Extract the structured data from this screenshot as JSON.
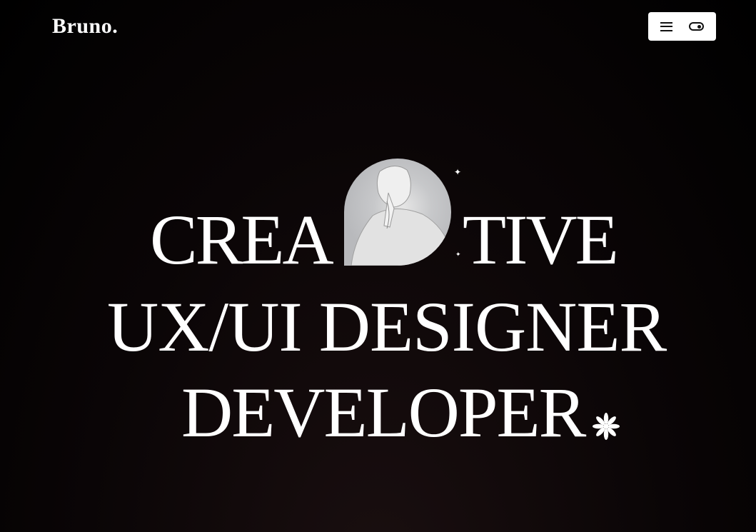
{
  "header": {
    "logo": "Bruno.",
    "menu_icon": "hamburger-icon",
    "theme_icon": "toggle-icon"
  },
  "hero": {
    "line1_left": "CREA",
    "line1_right": "TIVE",
    "line2": "UX/UI DESIGNER",
    "line3": "DEVELOPER",
    "sparkle": "✦"
  },
  "colors": {
    "background": "#000000",
    "text": "#ffffff",
    "button_bg": "#ffffff"
  }
}
